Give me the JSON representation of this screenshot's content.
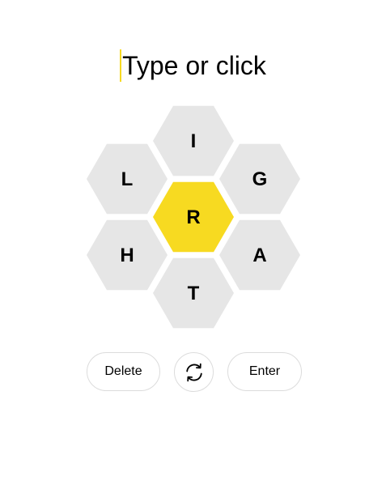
{
  "input": {
    "placeholder": "Type or click",
    "cursor_color": "#f7da21"
  },
  "hive": {
    "center_letter": "R",
    "outer_letters": [
      "I",
      "G",
      "A",
      "T",
      "H",
      "L"
    ],
    "center_color": "#f7da21",
    "outer_color": "#e6e6e6",
    "letter_color": "#000000"
  },
  "actions": {
    "delete_label": "Delete",
    "shuffle_icon": "shuffle-icon",
    "enter_label": "Enter"
  }
}
